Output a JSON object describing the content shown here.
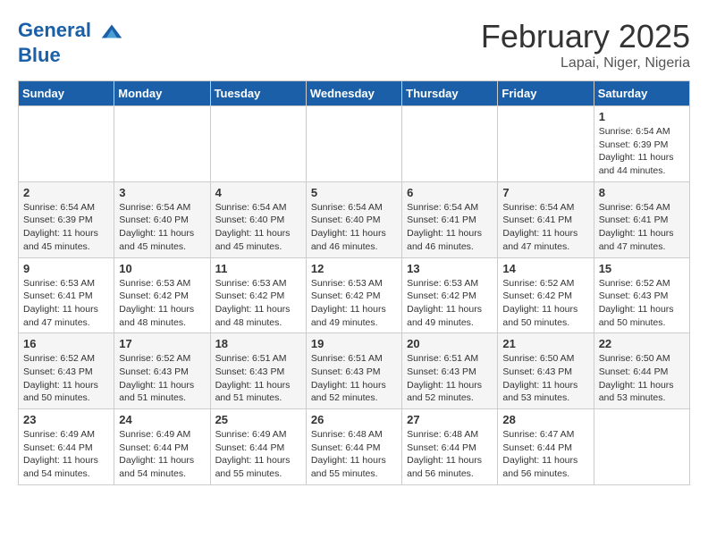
{
  "header": {
    "logo_line1": "General",
    "logo_line2": "Blue",
    "month_title": "February 2025",
    "subtitle": "Lapai, Niger, Nigeria"
  },
  "days_of_week": [
    "Sunday",
    "Monday",
    "Tuesday",
    "Wednesday",
    "Thursday",
    "Friday",
    "Saturday"
  ],
  "weeks": [
    [
      {
        "day": "",
        "info": ""
      },
      {
        "day": "",
        "info": ""
      },
      {
        "day": "",
        "info": ""
      },
      {
        "day": "",
        "info": ""
      },
      {
        "day": "",
        "info": ""
      },
      {
        "day": "",
        "info": ""
      },
      {
        "day": "1",
        "info": "Sunrise: 6:54 AM\nSunset: 6:39 PM\nDaylight: 11 hours\nand 44 minutes."
      }
    ],
    [
      {
        "day": "2",
        "info": "Sunrise: 6:54 AM\nSunset: 6:39 PM\nDaylight: 11 hours\nand 45 minutes."
      },
      {
        "day": "3",
        "info": "Sunrise: 6:54 AM\nSunset: 6:40 PM\nDaylight: 11 hours\nand 45 minutes."
      },
      {
        "day": "4",
        "info": "Sunrise: 6:54 AM\nSunset: 6:40 PM\nDaylight: 11 hours\nand 45 minutes."
      },
      {
        "day": "5",
        "info": "Sunrise: 6:54 AM\nSunset: 6:40 PM\nDaylight: 11 hours\nand 46 minutes."
      },
      {
        "day": "6",
        "info": "Sunrise: 6:54 AM\nSunset: 6:41 PM\nDaylight: 11 hours\nand 46 minutes."
      },
      {
        "day": "7",
        "info": "Sunrise: 6:54 AM\nSunset: 6:41 PM\nDaylight: 11 hours\nand 47 minutes."
      },
      {
        "day": "8",
        "info": "Sunrise: 6:54 AM\nSunset: 6:41 PM\nDaylight: 11 hours\nand 47 minutes."
      }
    ],
    [
      {
        "day": "9",
        "info": "Sunrise: 6:53 AM\nSunset: 6:41 PM\nDaylight: 11 hours\nand 47 minutes."
      },
      {
        "day": "10",
        "info": "Sunrise: 6:53 AM\nSunset: 6:42 PM\nDaylight: 11 hours\nand 48 minutes."
      },
      {
        "day": "11",
        "info": "Sunrise: 6:53 AM\nSunset: 6:42 PM\nDaylight: 11 hours\nand 48 minutes."
      },
      {
        "day": "12",
        "info": "Sunrise: 6:53 AM\nSunset: 6:42 PM\nDaylight: 11 hours\nand 49 minutes."
      },
      {
        "day": "13",
        "info": "Sunrise: 6:53 AM\nSunset: 6:42 PM\nDaylight: 11 hours\nand 49 minutes."
      },
      {
        "day": "14",
        "info": "Sunrise: 6:52 AM\nSunset: 6:42 PM\nDaylight: 11 hours\nand 50 minutes."
      },
      {
        "day": "15",
        "info": "Sunrise: 6:52 AM\nSunset: 6:43 PM\nDaylight: 11 hours\nand 50 minutes."
      }
    ],
    [
      {
        "day": "16",
        "info": "Sunrise: 6:52 AM\nSunset: 6:43 PM\nDaylight: 11 hours\nand 50 minutes."
      },
      {
        "day": "17",
        "info": "Sunrise: 6:52 AM\nSunset: 6:43 PM\nDaylight: 11 hours\nand 51 minutes."
      },
      {
        "day": "18",
        "info": "Sunrise: 6:51 AM\nSunset: 6:43 PM\nDaylight: 11 hours\nand 51 minutes."
      },
      {
        "day": "19",
        "info": "Sunrise: 6:51 AM\nSunset: 6:43 PM\nDaylight: 11 hours\nand 52 minutes."
      },
      {
        "day": "20",
        "info": "Sunrise: 6:51 AM\nSunset: 6:43 PM\nDaylight: 11 hours\nand 52 minutes."
      },
      {
        "day": "21",
        "info": "Sunrise: 6:50 AM\nSunset: 6:43 PM\nDaylight: 11 hours\nand 53 minutes."
      },
      {
        "day": "22",
        "info": "Sunrise: 6:50 AM\nSunset: 6:44 PM\nDaylight: 11 hours\nand 53 minutes."
      }
    ],
    [
      {
        "day": "23",
        "info": "Sunrise: 6:49 AM\nSunset: 6:44 PM\nDaylight: 11 hours\nand 54 minutes."
      },
      {
        "day": "24",
        "info": "Sunrise: 6:49 AM\nSunset: 6:44 PM\nDaylight: 11 hours\nand 54 minutes."
      },
      {
        "day": "25",
        "info": "Sunrise: 6:49 AM\nSunset: 6:44 PM\nDaylight: 11 hours\nand 55 minutes."
      },
      {
        "day": "26",
        "info": "Sunrise: 6:48 AM\nSunset: 6:44 PM\nDaylight: 11 hours\nand 55 minutes."
      },
      {
        "day": "27",
        "info": "Sunrise: 6:48 AM\nSunset: 6:44 PM\nDaylight: 11 hours\nand 56 minutes."
      },
      {
        "day": "28",
        "info": "Sunrise: 6:47 AM\nSunset: 6:44 PM\nDaylight: 11 hours\nand 56 minutes."
      },
      {
        "day": "",
        "info": ""
      }
    ]
  ]
}
